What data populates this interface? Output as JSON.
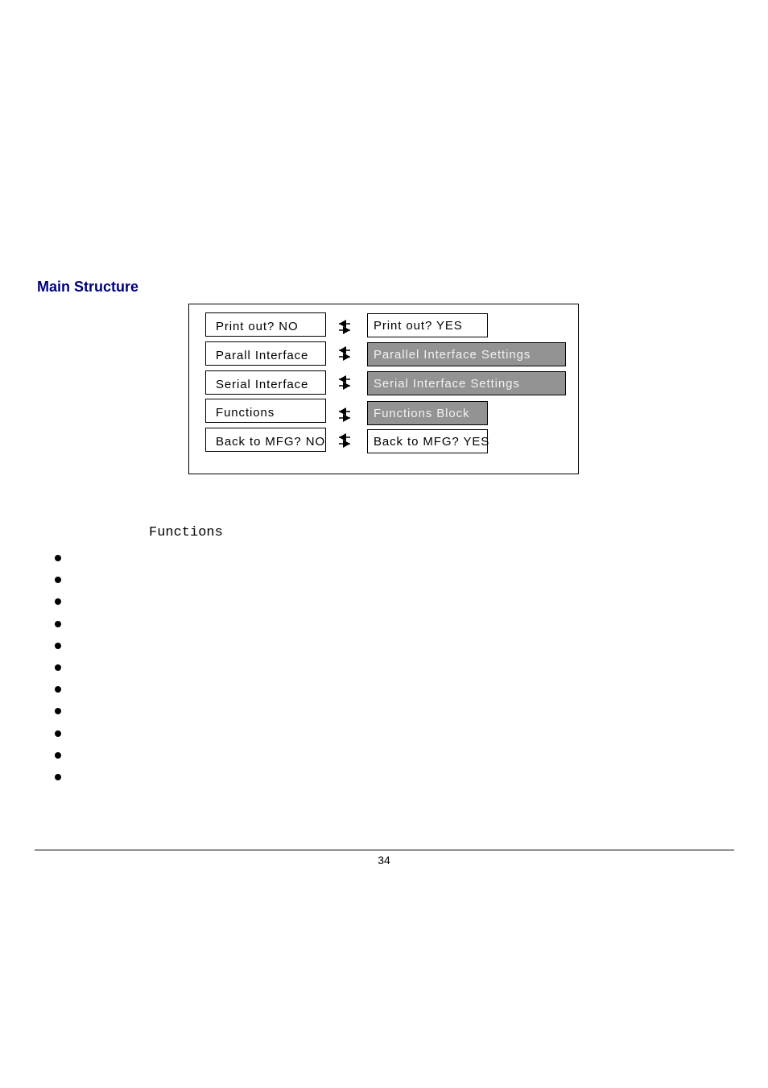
{
  "section": {
    "heading": "Main Structure"
  },
  "diagram": {
    "rows": [
      {
        "left_label": "Print out? NO",
        "right_label": "Print out? YES",
        "right_style": "white",
        "right_width": "narrow",
        "connector_icon": "bidirectional-arrow-icon"
      },
      {
        "left_label": "Parall Interface",
        "right_label": "Parallel Interface Settings",
        "right_style": "gray",
        "right_width": "wide",
        "connector_icon": "bidirectional-arrow-icon"
      },
      {
        "left_label": "Serial Interface",
        "right_label": "Serial Interface Settings",
        "right_style": "gray",
        "right_width": "wide",
        "connector_icon": "bidirectional-arrow-icon"
      },
      {
        "left_label": "Functions",
        "right_label": "Functions Block",
        "right_style": "gray",
        "right_width": "narrow",
        "connector_icon": "bidirectional-arrow-icon"
      },
      {
        "left_label": "Back to MFG? NO",
        "right_label": "Back to MFG? YES",
        "right_style": "white",
        "right_width": "narrow",
        "connector_icon": "bidirectional-arrow-icon"
      }
    ],
    "colors": {
      "gray_box": "#939393",
      "gray_box_text": "#f2f2f2",
      "heading": "#000080"
    }
  },
  "functions": {
    "heading": "Functions",
    "bullet_count": 11,
    "bullets": [
      "",
      "",
      "",
      "",
      "",
      "",
      "",
      "",
      "",
      "",
      ""
    ]
  },
  "footer": {
    "page_number": "34"
  }
}
